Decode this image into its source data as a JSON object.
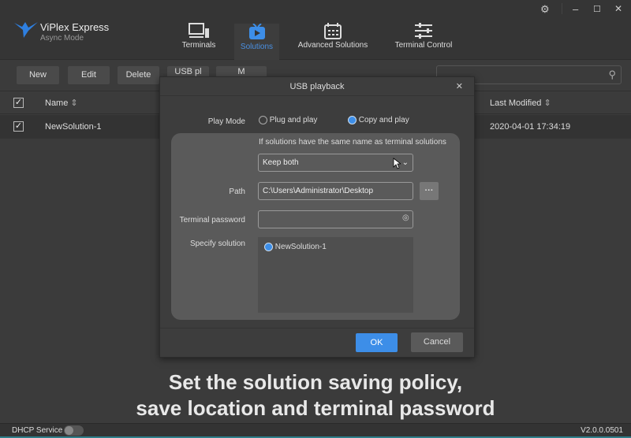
{
  "app": {
    "name": "ViPlex Express",
    "mode": "Async Mode"
  },
  "nav": [
    {
      "label": "Terminals",
      "icon": "monitor-icon"
    },
    {
      "label": "Solutions",
      "icon": "play-tv-icon",
      "active": true
    },
    {
      "label": "Advanced Solutions",
      "icon": "calendar-icon"
    },
    {
      "label": "Terminal Control",
      "icon": "sliders-icon"
    }
  ],
  "window": {
    "settings": "⚙",
    "minimize": "–",
    "maximize": "☐",
    "close": "✕"
  },
  "toolbar": {
    "new": "New",
    "edit": "Edit",
    "delete": "Delete",
    "usb": "USB pl",
    "more": "M"
  },
  "table": {
    "headers": [
      "Name",
      "Last Modified"
    ],
    "rows": [
      {
        "name": "NewSolution-1",
        "modified": "2020-04-01 17:34:19"
      }
    ]
  },
  "dialog": {
    "title": "USB playback",
    "close": "✕",
    "play_mode_label": "Play Mode",
    "options": [
      "Plug and play",
      "Copy and play"
    ],
    "selected": "Copy and play",
    "same_name_label": "If solutions have the same name as terminal solutions",
    "same_name_value": "Keep both",
    "path_label": "Path",
    "path_value": "C:\\Users\\Administrator\\Desktop",
    "browse": "···",
    "password_label": "Terminal password",
    "password_value": "",
    "specify_label": "Specify solution",
    "solutions": [
      "NewSolution-1"
    ],
    "ok": "OK",
    "cancel": "Cancel"
  },
  "caption": {
    "line1": "Set the solution saving policy,",
    "line2": "save location and terminal password"
  },
  "status": {
    "dhcp": "DHCP Service",
    "dhcp_on": false,
    "version": "V2.0.0.0501"
  },
  "colors": {
    "accent": "#3d8ee8",
    "background": "#3b3b3b"
  }
}
